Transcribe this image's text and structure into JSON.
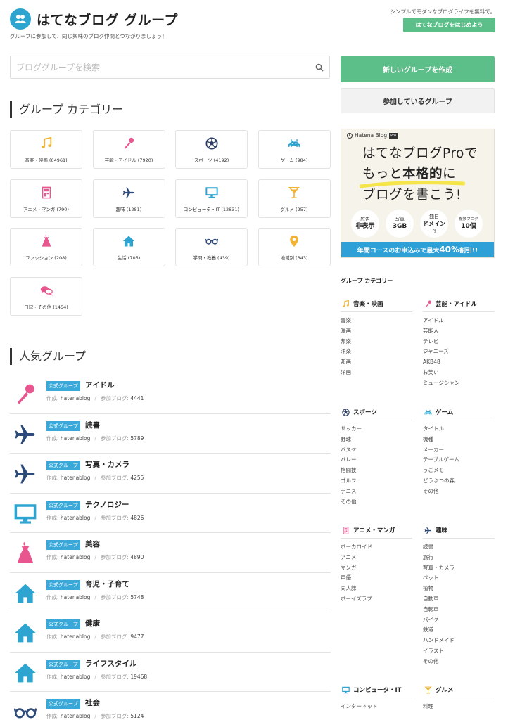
{
  "header": {
    "title": "はてなブログ グループ",
    "tagline": "グループに参加して、同じ興味のブログ仲間とつながりましょう！",
    "promo_text": "シンプルでモダンなブログライフを無料で。",
    "start_button": "はてなブログをはじめよう"
  },
  "search": {
    "placeholder": "ブロググループを検索"
  },
  "actions": {
    "create": "新しいグループを作成",
    "joined": "参加しているグループ"
  },
  "categories_heading": "グループ カテゴリー",
  "categories": [
    {
      "label": "音楽・映画 (64961)",
      "icon": "music-note-icon",
      "color": "#f2b233"
    },
    {
      "label": "芸能・アイドル (7920)",
      "icon": "microphone-icon",
      "color": "#e8558f"
    },
    {
      "label": "スポーツ (4192)",
      "icon": "soccer-ball-icon",
      "color": "#2c3e66"
    },
    {
      "label": "ゲーム (984)",
      "icon": "space-invader-icon",
      "color": "#2ea5d0"
    },
    {
      "label": "アニメ・マンガ (790)",
      "icon": "manga-book-icon",
      "color": "#e8558f"
    },
    {
      "label": "趣味 (1281)",
      "icon": "airplane-icon",
      "color": "#2c4a7a"
    },
    {
      "label": "コンピュータ・IT (12831)",
      "icon": "monitor-icon",
      "color": "#2ea5d0"
    },
    {
      "label": "グルメ (257)",
      "icon": "cocktail-icon",
      "color": "#f2b233"
    },
    {
      "label": "ファッション (208)",
      "icon": "dress-icon",
      "color": "#e8558f"
    },
    {
      "label": "生活 (705)",
      "icon": "house-icon",
      "color": "#2ea5d0"
    },
    {
      "label": "学問・教養 (439)",
      "icon": "glasses-icon",
      "color": "#2c4a7a"
    },
    {
      "label": "地域別 (343)",
      "icon": "map-pin-icon",
      "color": "#f2b233"
    },
    {
      "label": "日記・その他 (1454)",
      "icon": "chat-bubbles-icon",
      "color": "#e8558f"
    }
  ],
  "popular_heading": "人気グループ",
  "popular_groups": [
    {
      "badge": "公式グループ",
      "name": "アイドル",
      "author_label": "作成:",
      "author": "hatenablog",
      "count_label": "参加ブログ:",
      "count": "4441",
      "icon": "microphone-icon"
    },
    {
      "badge": "公式グループ",
      "name": "読書",
      "author_label": "作成:",
      "author": "hatenablog",
      "count_label": "参加ブログ:",
      "count": "5789",
      "icon": "airplane-icon"
    },
    {
      "badge": "公式グループ",
      "name": "写真・カメラ",
      "author_label": "作成:",
      "author": "hatenablog",
      "count_label": "参加ブログ:",
      "count": "4255",
      "icon": "airplane-icon"
    },
    {
      "badge": "公式グループ",
      "name": "テクノロジー",
      "author_label": "作成:",
      "author": "hatenablog",
      "count_label": "参加ブログ:",
      "count": "4826",
      "icon": "monitor-icon"
    },
    {
      "badge": "公式グループ",
      "name": "美容",
      "author_label": "作成:",
      "author": "hatenablog",
      "count_label": "参加ブログ:",
      "count": "4890",
      "icon": "dress-icon"
    },
    {
      "badge": "公式グループ",
      "name": "育児・子育て",
      "author_label": "作成:",
      "author": "hatenablog",
      "count_label": "参加ブログ:",
      "count": "5748",
      "icon": "house-icon"
    },
    {
      "badge": "公式グループ",
      "name": "健康",
      "author_label": "作成:",
      "author": "hatenablog",
      "count_label": "参加ブログ:",
      "count": "9477",
      "icon": "house-icon"
    },
    {
      "badge": "公式グループ",
      "name": "ライフスタイル",
      "author_label": "作成:",
      "author": "hatenablog",
      "count_label": "参加ブログ:",
      "count": "19468",
      "icon": "house-icon"
    },
    {
      "badge": "公式グループ",
      "name": "社会",
      "author_label": "作成:",
      "author": "hatenablog",
      "count_label": "参加ブログ:",
      "count": "5124",
      "icon": "glasses-icon"
    }
  ],
  "ad": {
    "brand": "Hatena Blog",
    "brand_badge": "Pro",
    "line1": "はてなブログProで",
    "line2_a": "もっと",
    "line2_b": "本格的",
    "line2_c": "に",
    "line3": "ブログを書こう!",
    "badges": [
      {
        "small": "広告",
        "big": "非表示"
      },
      {
        "small": "写真",
        "big": "3GB"
      },
      {
        "small": "独自",
        "big": "ドメイン",
        "note": "可"
      },
      {
        "small": "複数ブログ",
        "big": "10個"
      }
    ],
    "banner_a": "年間コースのお申込みで最大",
    "banner_b": "40%",
    "banner_c": "割引!!"
  },
  "sidebar": {
    "title": "グループ カテゴリー",
    "categories": [
      {
        "name": "音楽・映画",
        "icon": "music-note-icon",
        "items": [
          "音楽",
          "映画",
          "邦楽",
          "洋楽",
          "邦画",
          "洋画"
        ]
      },
      {
        "name": "芸能・アイドル",
        "icon": "microphone-icon",
        "items": [
          "アイドル",
          "芸能人",
          "テレビ",
          "ジャニーズ",
          "AKB48",
          "お笑い",
          "ミュージシャン"
        ]
      },
      {
        "name": "スポーツ",
        "icon": "soccer-ball-icon",
        "items": [
          "サッカー",
          "野球",
          "バスケ",
          "バレー",
          "格闘技",
          "ゴルフ",
          "テニス",
          "その他"
        ]
      },
      {
        "name": "ゲーム",
        "icon": "space-invader-icon",
        "items": [
          "タイトル",
          "機種",
          "メーカー",
          "テーブルゲーム",
          "うごメモ",
          "どうぶつの森",
          "その他"
        ]
      },
      {
        "name": "アニメ・マンガ",
        "icon": "manga-book-icon",
        "items": [
          "ボーカロイド",
          "アニメ",
          "マンガ",
          "声優",
          "同人誌",
          "ボーイズラブ"
        ]
      },
      {
        "name": "趣味",
        "icon": "airplane-icon",
        "items": [
          "読書",
          "旅行",
          "写真・カメラ",
          "ペット",
          "植物",
          "自動車",
          "自転車",
          "バイク",
          "鉄道",
          "ハンドメイド",
          "イラスト",
          "その他"
        ]
      },
      {
        "name": "コンピュータ・IT",
        "icon": "monitor-icon",
        "items": [
          "インターネット"
        ]
      },
      {
        "name": "グルメ",
        "icon": "cocktail-icon",
        "items": [
          "料理"
        ]
      }
    ]
  }
}
